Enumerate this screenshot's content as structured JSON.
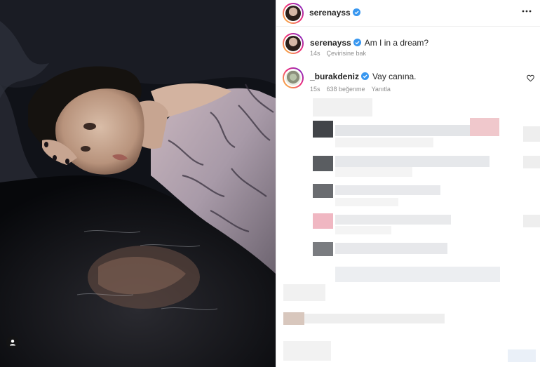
{
  "post": {
    "author": "serenayss",
    "verified": true
  },
  "caption": {
    "username": "serenayss",
    "text": "Am I in a dream?",
    "time": "14s",
    "translate": "Çevirisine bak"
  },
  "comments": [
    {
      "username": "_burakdeniz",
      "verified": true,
      "text": "Vay canına.",
      "time": "15s",
      "likes": "638 beğenme",
      "reply": "Yanıtla"
    }
  ],
  "icons": {
    "more": "more-options-icon",
    "verified": "verified-badge-icon",
    "like": "heart-icon",
    "tag": "user-tag-icon"
  },
  "colors": {
    "verified": "#3897f0",
    "text": "#262626",
    "secondary": "#8e8e8e",
    "border": "#efefef"
  }
}
